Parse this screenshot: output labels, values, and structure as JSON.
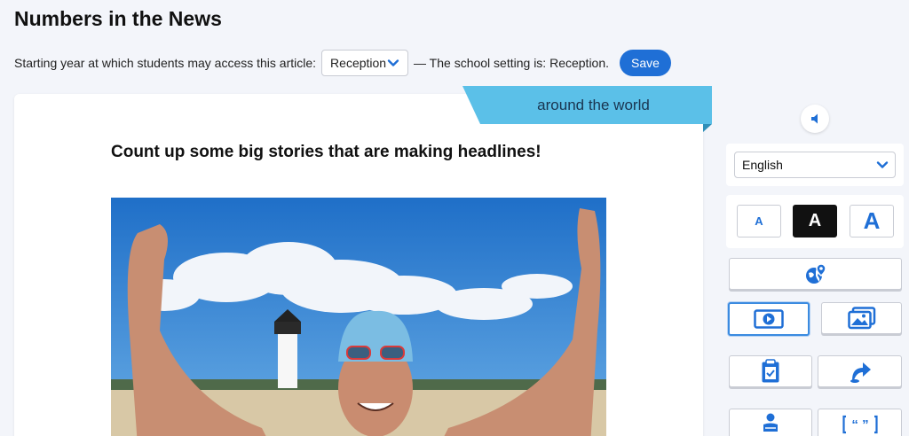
{
  "page": {
    "title": "Numbers in the News"
  },
  "settings": {
    "label": "Starting year at which students may access this article:",
    "selected_year": "Reception",
    "note": "— The school setting is: Reception.",
    "save_label": "Save"
  },
  "article": {
    "category": "around the world",
    "headline": "Count up some big stories that are making headlines!"
  },
  "sidebar": {
    "language": "English",
    "text_size": {
      "small": "A",
      "medium": "A",
      "large": "A",
      "active": "medium"
    },
    "tools": [
      "map-pin-globe-icon",
      "video-icon",
      "image-gallery-icon",
      "clipboard-check-icon",
      "share-arrow-icon",
      "person-reading-icon",
      "quote-icon"
    ]
  },
  "colors": {
    "accent": "#1f6fd6",
    "tab": "#5bc0e8",
    "background": "#f3f5fa"
  }
}
